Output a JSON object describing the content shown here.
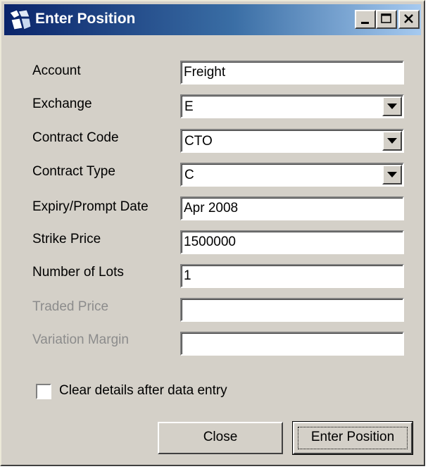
{
  "window": {
    "title": "Enter Position"
  },
  "form": {
    "fields": [
      {
        "label": "Account",
        "value": "Freight",
        "type": "text",
        "enabled": true
      },
      {
        "label": "Exchange",
        "value": "E",
        "type": "select",
        "enabled": true
      },
      {
        "label": "Contract Code",
        "value": "CTO",
        "type": "select",
        "enabled": true
      },
      {
        "label": "Contract Type",
        "value": "C",
        "type": "select",
        "enabled": true
      },
      {
        "label": "Expiry/Prompt Date",
        "value": "Apr 2008",
        "type": "text",
        "enabled": true
      },
      {
        "label": "Strike Price",
        "value": "1500000",
        "type": "text",
        "enabled": true
      },
      {
        "label": "Number of Lots",
        "value": "1",
        "type": "text",
        "enabled": true
      },
      {
        "label": "Traded Price",
        "value": "",
        "type": "text",
        "enabled": false
      },
      {
        "label": "Variation Margin",
        "value": "",
        "type": "text",
        "enabled": false
      }
    ],
    "clear_checkbox": {
      "label": "Clear details after data entry",
      "checked": false
    }
  },
  "buttons": {
    "close": "Close",
    "enter": "Enter Position"
  },
  "colors": {
    "face": "#d4d0c8",
    "title_start": "#0a246a",
    "title_end": "#a6caf0",
    "disabled_text": "#8c8c8c"
  },
  "icons": [
    "app-icon",
    "minimize-icon",
    "maximize-icon",
    "close-icon",
    "dropdown-arrow-icon"
  ]
}
